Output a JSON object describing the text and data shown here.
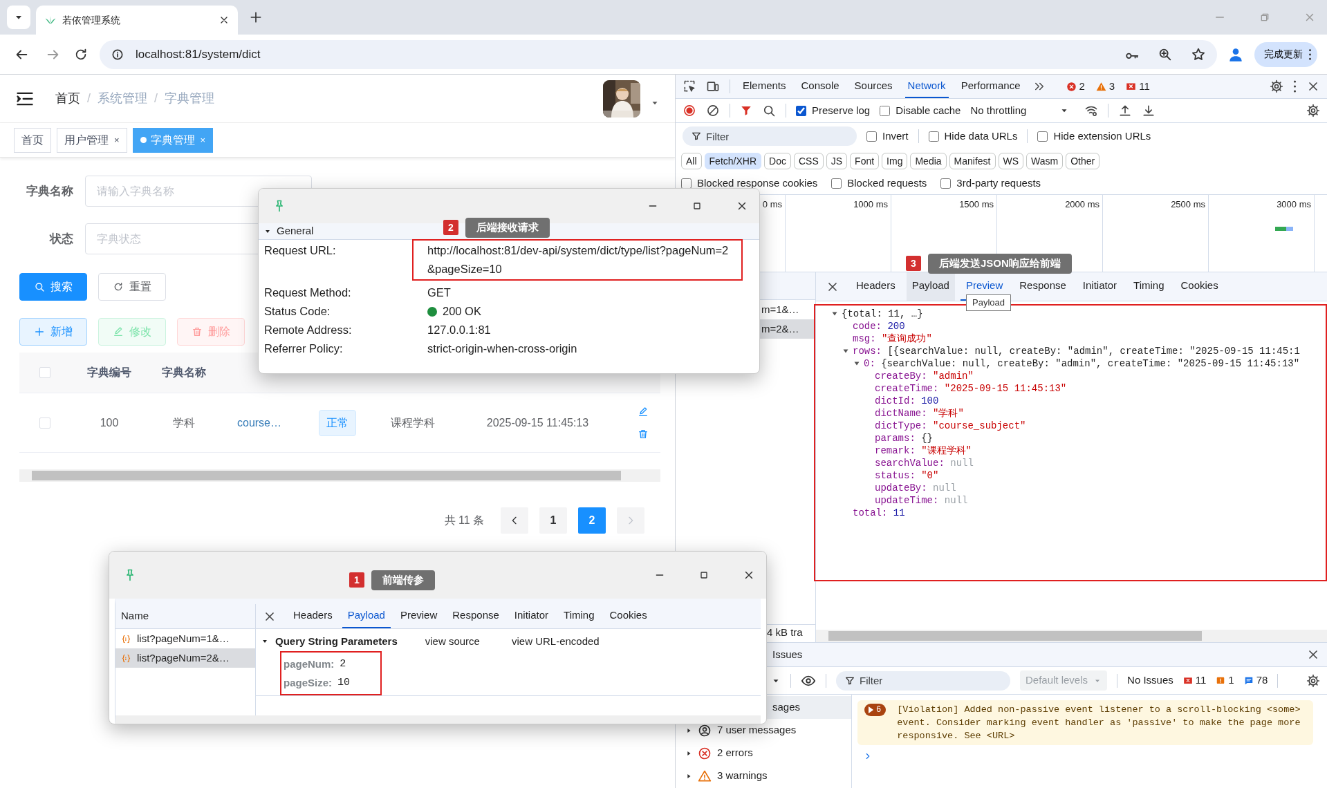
{
  "browser": {
    "tab_title": "若依管理系统",
    "url": "localhost:81/system/dict",
    "update_button": "完成更新"
  },
  "app": {
    "breadcrumb": {
      "separator": "/",
      "items": [
        {
          "label": "首页",
          "link": true
        },
        {
          "label": "系统管理",
          "link": false
        },
        {
          "label": "字典管理",
          "link": false
        }
      ]
    },
    "tags": [
      {
        "label": "首页",
        "selected": false
      },
      {
        "label": "用户管理",
        "selected": false,
        "close": "×"
      },
      {
        "label": "字典管理",
        "selected": true,
        "close": "×"
      }
    ],
    "filters": [
      {
        "label": "字典名称",
        "placeholder": "请输入字典名称"
      },
      {
        "label": "状态",
        "placeholder": "字典状态"
      }
    ],
    "search_buttons": [
      {
        "label": "搜索",
        "kind": "search"
      },
      {
        "label": "重置",
        "kind": "reset"
      }
    ],
    "actions": [
      {
        "label": "新增",
        "kind": "add",
        "disabled": false
      },
      {
        "label": "修改",
        "kind": "edit",
        "disabled": true
      },
      {
        "label": "删除",
        "kind": "delete",
        "disabled": true
      }
    ],
    "table": {
      "all_checked": false,
      "columns": [
        "字典编号",
        "字典名称"
      ],
      "rows": [
        {
          "checked": false,
          "dict_id": "100",
          "dict_name": "学科",
          "dict_type": "course…",
          "status": "正常",
          "remark": "课程学科",
          "create_time": "2025-09-15 11:45:13"
        }
      ]
    },
    "pagination": {
      "total": "共 11 条",
      "pages": [
        {
          "label": "1",
          "selected": false
        },
        {
          "label": "2",
          "selected": true
        }
      ]
    }
  },
  "devtools": {
    "tabs": [
      {
        "label": "Elements",
        "selected": false
      },
      {
        "label": "Console",
        "selected": false
      },
      {
        "label": "Sources",
        "selected": false
      },
      {
        "label": "Network",
        "selected": true
      },
      {
        "label": "Performance",
        "selected": false
      }
    ],
    "counts": [
      {
        "kind": "error",
        "count": "2"
      },
      {
        "kind": "warning",
        "count": "3"
      },
      {
        "kind": "issue",
        "count": "11"
      }
    ],
    "recording": true,
    "toolbar_options": [
      {
        "label": "Preserve log",
        "checked": true
      },
      {
        "label": "Disable cache",
        "checked": false
      }
    ],
    "throttling": "No throttling",
    "filter_placeholder": "Filter",
    "filter_options": [
      {
        "label": "Invert",
        "checked": false
      },
      {
        "label": "Hide data URLs",
        "checked": false
      },
      {
        "label": "Hide extension URLs",
        "checked": false
      }
    ],
    "types": [
      {
        "label": "All",
        "selected": false
      },
      {
        "label": "Fetch/XHR",
        "selected": true
      },
      {
        "label": "Doc",
        "selected": false
      },
      {
        "label": "CSS",
        "selected": false
      },
      {
        "label": "JS",
        "selected": false
      },
      {
        "label": "Font",
        "selected": false
      },
      {
        "label": "Img",
        "selected": false
      },
      {
        "label": "Media",
        "selected": false
      },
      {
        "label": "Manifest",
        "selected": false
      },
      {
        "label": "WS",
        "selected": false
      },
      {
        "label": "Wasm",
        "selected": false
      },
      {
        "label": "Other",
        "selected": false
      }
    ],
    "blocked_options": [
      {
        "label": "Blocked response cookies",
        "checked": false
      },
      {
        "label": "Blocked requests",
        "checked": false
      },
      {
        "label": "3rd-party requests",
        "checked": false
      }
    ],
    "timeline_ticks": [
      "0 ms",
      "1000 ms",
      "1500 ms",
      "2000 ms",
      "2500 ms",
      "3000 ms"
    ],
    "requests": [
      {
        "name": "m=1&…",
        "selected": false
      },
      {
        "name": "m=2&…",
        "selected": true
      }
    ],
    "summary": "4 kB tra",
    "detail_tabs": [
      {
        "label": "Headers",
        "selected": false,
        "hovered": false
      },
      {
        "label": "Payload",
        "selected": false,
        "hovered": true
      },
      {
        "label": "Preview",
        "selected": true,
        "hovered": false
      },
      {
        "label": "Response",
        "selected": false,
        "hovered": false
      },
      {
        "label": "Initiator",
        "selected": false,
        "hovered": false
      },
      {
        "label": "Timing",
        "selected": false,
        "hovered": false
      },
      {
        "label": "Cookies",
        "selected": false,
        "hovered": false
      }
    ],
    "tooltip": "Payload",
    "preview": [
      {
        "value": "{total: 11, …}",
        "kind": "object",
        "expanded": true,
        "children": [
          {
            "key": "code:",
            "value": "200",
            "kind": "number"
          },
          {
            "key": "msg:",
            "value": "\"查询成功\"",
            "kind": "string"
          },
          {
            "key": "rows:",
            "value": "[{searchValue: null, createBy: \"admin\", createTime: \"2025-09-15 11:45:1",
            "kind": "object",
            "expanded": true,
            "children": [
              {
                "key": "0:",
                "value": "{searchValue: null, createBy: \"admin\", createTime: \"2025-09-15 11:45:13\"",
                "kind": "object",
                "expanded": true,
                "children": [
                  {
                    "key": "createBy:",
                    "value": "\"admin\"",
                    "kind": "string"
                  },
                  {
                    "key": "createTime:",
                    "value": "\"2025-09-15 11:45:13\"",
                    "kind": "string"
                  },
                  {
                    "key": "dictId:",
                    "value": "100",
                    "kind": "number"
                  },
                  {
                    "key": "dictName:",
                    "value": "\"学科\"",
                    "kind": "string"
                  },
                  {
                    "key": "dictType:",
                    "value": "\"course_subject\"",
                    "kind": "string"
                  },
                  {
                    "key": "params:",
                    "value": "{}",
                    "kind": "object"
                  },
                  {
                    "key": "remark:",
                    "value": "\"课程学科\"",
                    "kind": "string"
                  },
                  {
                    "key": "searchValue:",
                    "value": "null",
                    "kind": "null"
                  },
                  {
                    "key": "status:",
                    "value": "\"0\"",
                    "kind": "string"
                  },
                  {
                    "key": "updateBy:",
                    "value": "null",
                    "kind": "null"
                  },
                  {
                    "key": "updateTime:",
                    "value": "null",
                    "kind": "null"
                  }
                ]
              }
            ]
          },
          {
            "key": "total:",
            "value": "11",
            "kind": "number"
          }
        ]
      }
    ],
    "drawer": {
      "tab": "Issues",
      "filter_placeholder": "Filter",
      "levels": "Default levels",
      "issues": "No Issues",
      "counts": [
        {
          "kind": "error",
          "count": "11"
        },
        {
          "kind": "warning",
          "count": "1"
        },
        {
          "kind": "info",
          "count": "78"
        }
      ],
      "sidebar": [
        {
          "label": "sages",
          "kind": "messages",
          "selected": true
        },
        {
          "label": "7 user messages",
          "kind": "user",
          "selected": false
        },
        {
          "label": "2 errors",
          "kind": "error",
          "selected": false
        },
        {
          "label": "3 warnings",
          "kind": "warning",
          "selected": false
        }
      ],
      "messages": [
        {
          "kind": "violation",
          "repeat": "6",
          "text": "[Violation] Added non-passive event listener to a scroll-blocking <some> event. Consider marking event handler as 'passive' to make the page more responsive. See <URL>"
        }
      ]
    }
  },
  "general_window": {
    "section": "General",
    "expanded": true,
    "fields": [
      {
        "label": "Request URL:",
        "value": "http://localhost:81/dev-api/system/dict/type/list?pageNum=2&pageSize=10"
      },
      {
        "label": "Request Method:",
        "value": "GET"
      },
      {
        "label": "Status Code:",
        "value": "200 OK",
        "color": "#1e8e3e"
      },
      {
        "label": "Remote Address:",
        "value": "127.0.0.1:81"
      },
      {
        "label": "Referrer Policy:",
        "value": "strict-origin-when-cross-origin"
      }
    ]
  },
  "payload_window": {
    "name_header": "Name",
    "requests": [
      {
        "name": "list?pageNum=1&…",
        "selected": false
      },
      {
        "name": "list?pageNum=2&…",
        "selected": true
      }
    ],
    "tabs": [
      {
        "label": "Headers",
        "selected": false
      },
      {
        "label": "Payload",
        "selected": true
      },
      {
        "label": "Preview",
        "selected": false
      },
      {
        "label": "Response",
        "selected": false
      },
      {
        "label": "Initiator",
        "selected": false
      },
      {
        "label": "Timing",
        "selected": false
      },
      {
        "label": "Cookies",
        "selected": false
      }
    ],
    "section": "Query String Parameters",
    "links": [
      "view source",
      "view URL-encoded"
    ],
    "params": [
      {
        "key": "pageNum:",
        "value": "2"
      },
      {
        "key": "pageSize:",
        "value": "10"
      }
    ]
  },
  "annotations": [
    {
      "number": "1",
      "text": "前端传参"
    },
    {
      "number": "2",
      "text": "后端接收请求"
    },
    {
      "number": "3",
      "text": "后端发送JSON响应给前端"
    }
  ]
}
